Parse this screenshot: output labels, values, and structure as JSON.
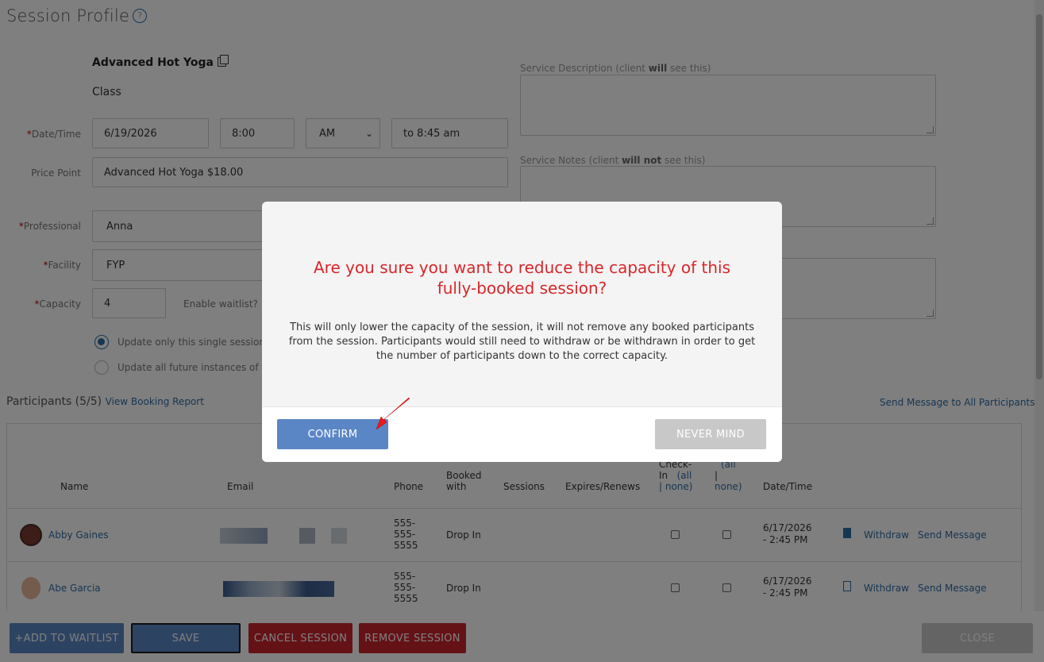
{
  "header": {
    "title": "Session Profile",
    "help_icon": "?"
  },
  "service": {
    "name": "Advanced Hot Yoga",
    "type": "Class"
  },
  "form": {
    "datetime_label": "*Date/Time",
    "date": "6/19/2026",
    "time": "8:00",
    "ampm": "AM",
    "end_time": "to 8:45 am",
    "price_label": "Price Point",
    "price": "Advanced Hot Yoga $18.00",
    "professional_label": "*Professional",
    "professional": "Anna",
    "facility_label": "*Facility",
    "facility": "FYP",
    "capacity_label": "*Capacity",
    "capacity": "4",
    "waitlist_label": "Enable waitlist?",
    "radio_single": "Update only this single session",
    "radio_future": "Update all future instances of thi"
  },
  "right_panel": {
    "desc_label_pre": "Service Description (client ",
    "desc_label_bold": "will",
    "desc_label_post": " see this)",
    "notes_label_pre": "Service Notes (client ",
    "notes_label_bold": "will not",
    "notes_label_post": " see this)"
  },
  "participants": {
    "title": "Participants (5/5)",
    "booking_report_link": "View Booking Report",
    "send_all_link": "Send Message to All Participants",
    "columns": {
      "name": "Name",
      "email": "Email",
      "phone": "Phone",
      "booked_with_1": "Booked",
      "booked_with_2": "with",
      "sessions": "Sessions",
      "expires": "Expires/Renews",
      "checkin_1": "Check-",
      "checkin_2": "In",
      "checkin_all": "(all",
      "checkin_none": "| none)",
      "col2_all": "(all",
      "col2_sep": "|",
      "col2_none": "none)",
      "datetime": "Date/Time"
    },
    "rows": [
      {
        "name": "Abby Gaines",
        "phone_1": "555-",
        "phone_2": "555-",
        "phone_3": "5555",
        "booked_with": "Drop In",
        "datetime_1": "6/17/2026",
        "datetime_2": "- 2:45 PM",
        "withdraw": "Withdraw",
        "send_message": "Send Message"
      },
      {
        "name": "Abe Garcia",
        "phone_1": "555-",
        "phone_2": "555-",
        "phone_3": "5555",
        "booked_with": "Drop In",
        "datetime_1": "6/17/2026",
        "datetime_2": "- 2:45 PM",
        "withdraw": "Withdraw",
        "send_message": "Send Message"
      }
    ]
  },
  "footer": {
    "add_waitlist": "+ADD TO WAITLIST",
    "save": "SAVE",
    "cancel_session": "CANCEL SESSION",
    "remove_session": "REMOVE SESSION",
    "close": "CLOSE"
  },
  "modal": {
    "title": "Are you sure you want to reduce the capacity of this fully-booked session?",
    "body": "This will only lower the capacity of the session, it will not remove any booked participants from the session. Participants would still need to withdraw or be withdrawn in order to get the number of participants down to the correct capacity.",
    "confirm": "CONFIRM",
    "never_mind": "NEVER MIND"
  },
  "colors": {
    "confirm_button": "#5b86c5",
    "never_mind_button": "#c8c8c8",
    "modal_title": "#d9262b",
    "annotation_arrow": "#e8191f"
  },
  "icons": [
    "help-icon",
    "copy-icon",
    "select-caret-icon",
    "document-icon",
    "avatar",
    "annotation-arrow"
  ]
}
